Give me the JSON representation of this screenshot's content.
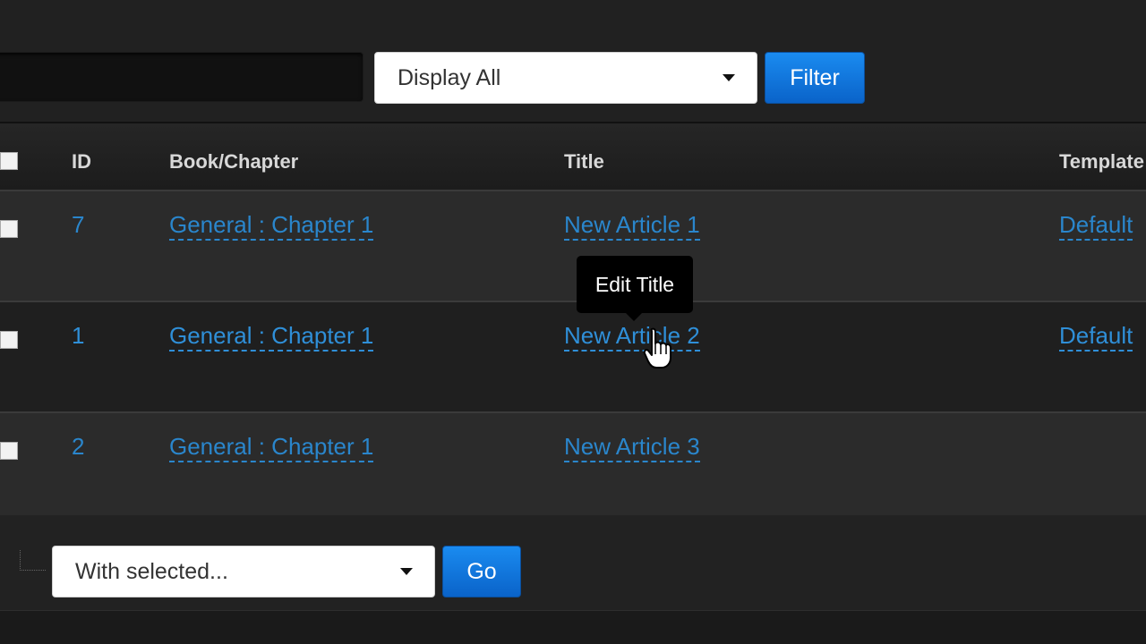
{
  "filter": {
    "display_select": "Display All",
    "filter_button": "Filter"
  },
  "table": {
    "headers": {
      "id": "ID",
      "book_chapter": "Book/Chapter",
      "title": "Title",
      "template": "Template"
    },
    "rows": [
      {
        "id": "7",
        "book_chapter": "General : Chapter 1",
        "title": "New Article 1",
        "template": "Default"
      },
      {
        "id": "1",
        "book_chapter": "General : Chapter 1",
        "title": "New Article 2",
        "template": "Default"
      },
      {
        "id": "2",
        "book_chapter": "General : Chapter 1",
        "title": "New Article 3",
        "template": ""
      }
    ]
  },
  "tooltip": {
    "text": "Edit Title"
  },
  "bulk": {
    "with_selected": "With selected...",
    "go_button": "Go"
  },
  "colors": {
    "link": "#2f8fd8",
    "button": "#0a63c9",
    "background": "#222222"
  }
}
